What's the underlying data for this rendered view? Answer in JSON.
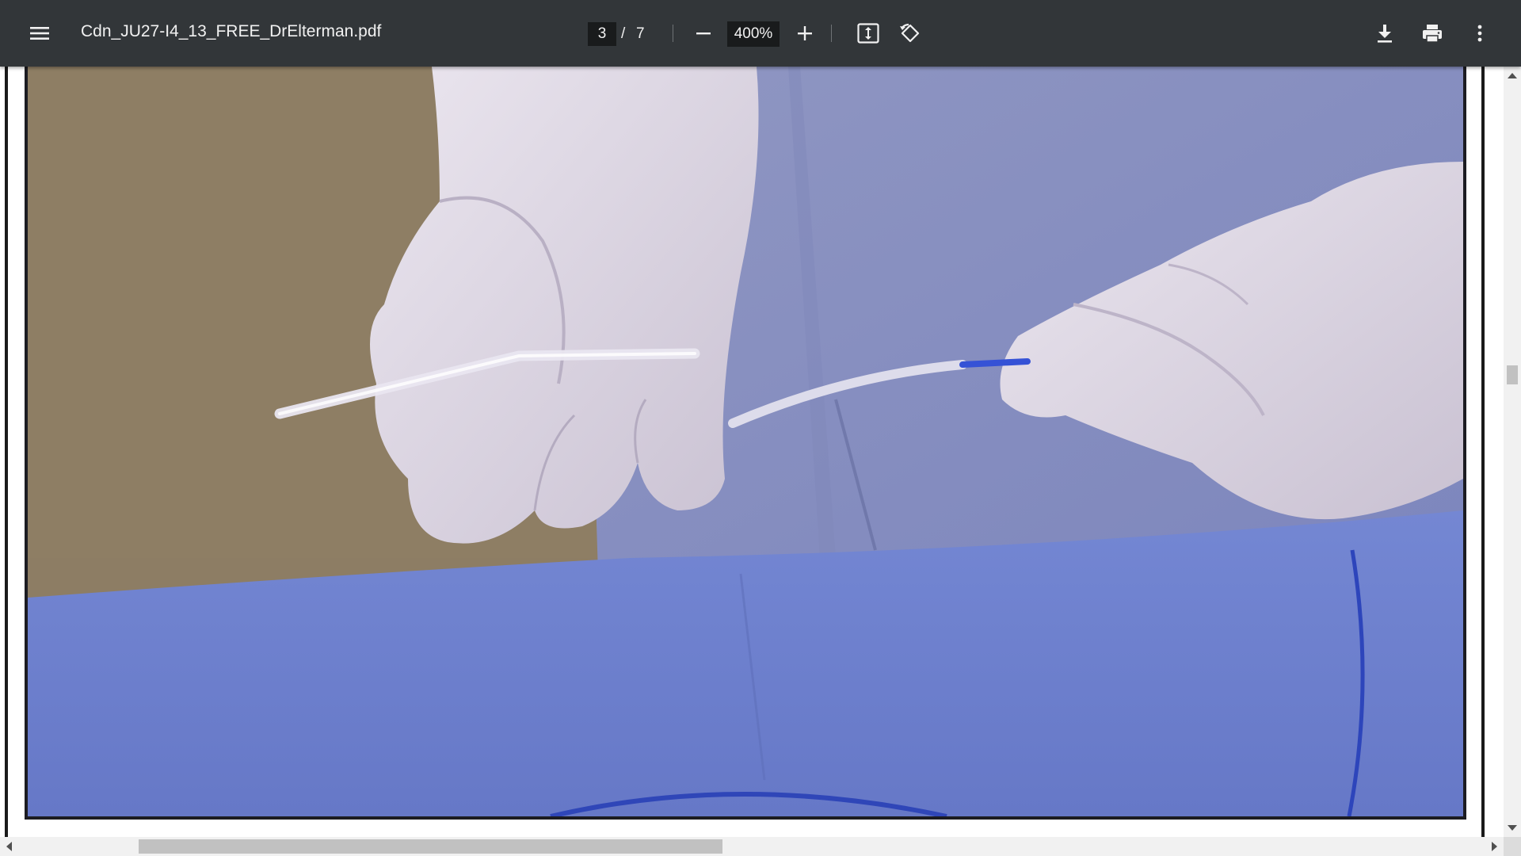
{
  "toolbar": {
    "menu_icon": "hamburger-menu-icon",
    "title": "Cdn_JU27-I4_13_FREE_DrElterman.pdf",
    "current_page": "3",
    "page_separator": "/",
    "total_pages": "7",
    "zoom_out_icon": "minus-icon",
    "zoom_level": "400%",
    "zoom_in_icon": "plus-icon",
    "fit_icon": "fit-to-page-icon",
    "rotate_icon": "rotate-counterclockwise-icon",
    "download_icon": "download-icon",
    "print_icon": "print-icon",
    "more_icon": "more-vertical-icon"
  },
  "viewer": {
    "page_content": "photograph: gloved hands holding a catheter over blue surgical drapes"
  },
  "colors": {
    "toolbar_bg": "#323639",
    "input_bg": "#191b1c",
    "text": "#f1f1f1",
    "drape_blue": "#6f82cc",
    "glove": "#d9d2dd",
    "wall": "#8d7d64"
  }
}
